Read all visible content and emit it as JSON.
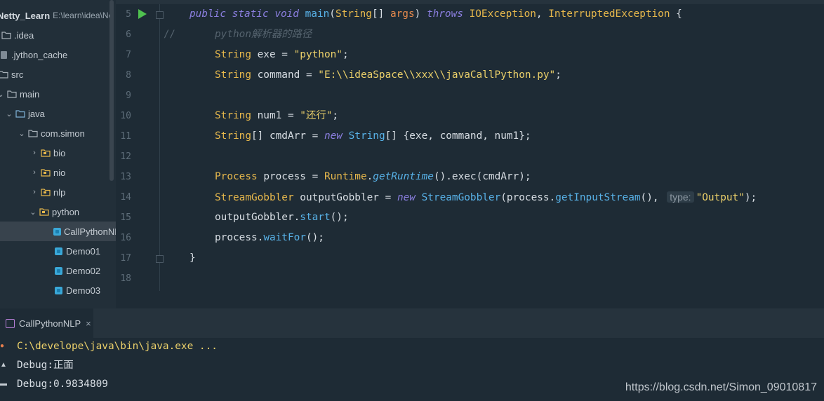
{
  "project_tree": {
    "root": {
      "name": "Netty_Learn",
      "path": "E:\\learn\\idea\\Ne"
    },
    "items": [
      {
        "label": ".idea",
        "type": "folder"
      },
      {
        "label": ".jython_cache",
        "type": "file"
      },
      {
        "label": "src",
        "type": "folder"
      },
      {
        "label": "main",
        "type": "folder"
      },
      {
        "label": "java",
        "type": "folder"
      },
      {
        "label": "com.simon",
        "type": "package"
      },
      {
        "label": "bio",
        "type": "package"
      },
      {
        "label": "nio",
        "type": "package"
      },
      {
        "label": "nlp",
        "type": "package"
      },
      {
        "label": "python",
        "type": "package"
      },
      {
        "label": "CallPythonNLP",
        "type": "class",
        "selected": true
      },
      {
        "label": "Demo01",
        "type": "class"
      },
      {
        "label": "Demo02",
        "type": "class"
      },
      {
        "label": "Demo03",
        "type": "class"
      }
    ]
  },
  "editor": {
    "line_numbers": [
      "5",
      "6",
      "7",
      "8",
      "9",
      "10",
      "11",
      "12",
      "13",
      "14",
      "15",
      "16",
      "17",
      "18"
    ],
    "line5": {
      "kw1": "public",
      "kw2": "static",
      "kw3": "void",
      "method": "main",
      "p1": "(",
      "type": "String",
      "p2": "[] ",
      "param": "args",
      "p3": ") ",
      "kw4": "throws",
      "ex1": "IOException",
      "p4": ", ",
      "ex2": "InterruptedException",
      "p5": " {"
    },
    "line6": {
      "marker": "//",
      "comment": "python解析器的路径"
    },
    "line7": {
      "type": "String",
      "rest": " exe = ",
      "value": "\"python\"",
      "end": ";"
    },
    "line8": {
      "type": "String",
      "rest": " command = ",
      "value": "\"E:\\\\ideaSpace\\\\xxx\\\\javaCallPython.py\"",
      "end": ";"
    },
    "line10": {
      "type": "String",
      "rest": " num1 = ",
      "value": "\"还行\"",
      "end": ";"
    },
    "line11": {
      "type": "String",
      "rest": "[] cmdArr = ",
      "kw": "new",
      "type2": "String",
      "rest2": "[] {exe, command, num1};"
    },
    "line13": {
      "type": "Process",
      "rest": " process = ",
      "cls": "Runtime",
      "dot": ".",
      "m1": "getRuntime",
      "rest2": "().exec(cmdArr);"
    },
    "line14": {
      "type": "StreamGobbler",
      "rest": " outputGobbler = ",
      "kw": "new",
      "cls": "StreamGobbler",
      "p1": "(process.",
      "m1": "getInputStream",
      "p2": "(),",
      "hint": "type:",
      "value": "\"Output\"",
      "end": ");"
    },
    "line15": {
      "obj": "outputGobbler.",
      "m": "start",
      "end": "();"
    },
    "line16": {
      "obj": "process.",
      "m": "waitFor",
      "end": "();"
    },
    "line17": {
      "brace": "}"
    }
  },
  "run_panel": {
    "tab_label": "CallPythonNLP",
    "tab_close": "×",
    "lines": [
      "C:\\develope\\java\\bin\\java.exe ...",
      "Debug:正面",
      "Debug:0.9834809"
    ]
  },
  "watermark": "https://blog.csdn.net/Simon_09010817",
  "colors": {
    "background": "#1e2b35",
    "keyword": "#8b7fe0",
    "string": "#ebd06a",
    "class": "#e7b84c",
    "method": "#58b2e8",
    "run": "#4fc14f"
  }
}
